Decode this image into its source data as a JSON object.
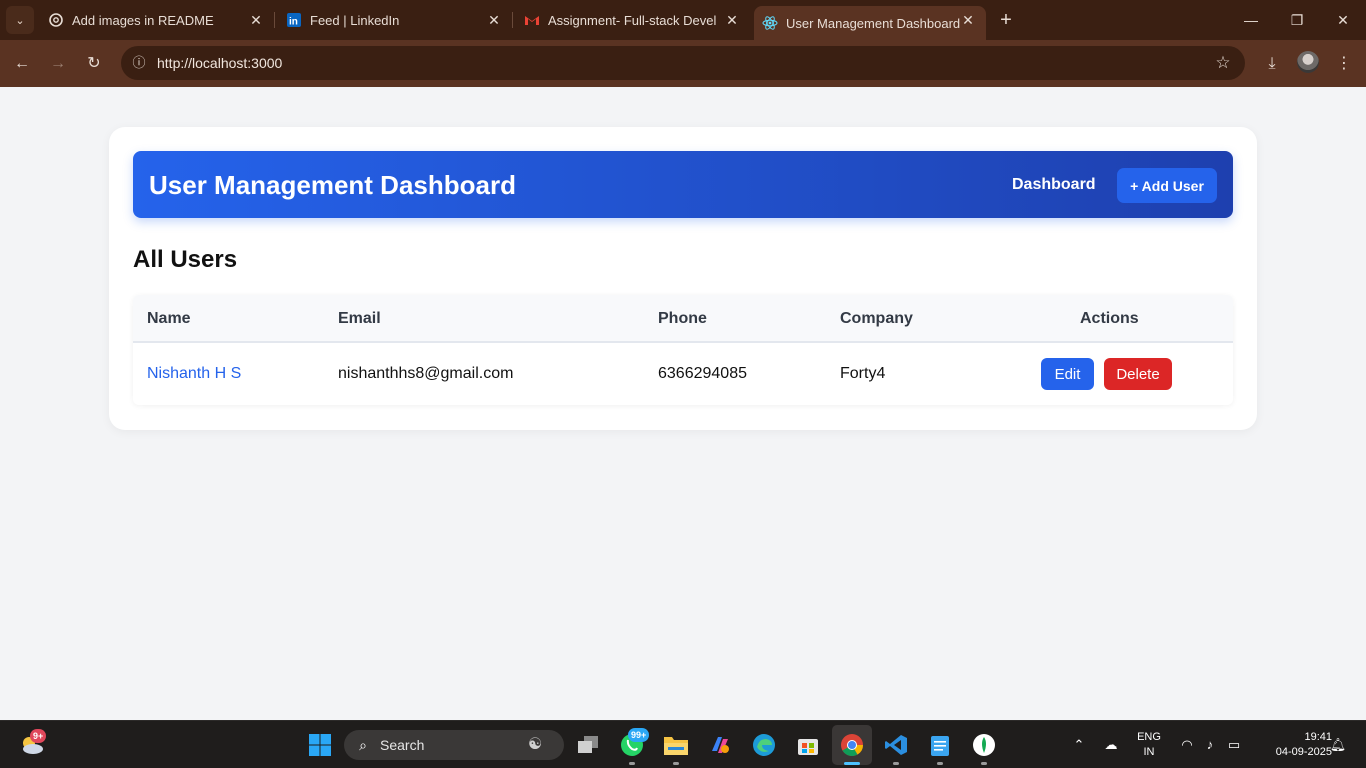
{
  "browser": {
    "tabs": [
      {
        "title": "Add images in README",
        "close": "✕"
      },
      {
        "title": "Feed | LinkedIn",
        "close": "✕"
      },
      {
        "title": "Assignment- Full-stack Develop",
        "close": "✕"
      },
      {
        "title": "User Management Dashboard",
        "close": "✕"
      }
    ],
    "new_tab": "+",
    "url": "http://localhost:3000",
    "window_controls": {
      "minimize": "—",
      "maximize": "❐",
      "close": "✕"
    }
  },
  "page": {
    "header": {
      "title": "User Management Dashboard",
      "nav_dashboard": "Dashboard",
      "add_user_button": "+ Add User"
    },
    "section_title": "All Users",
    "table": {
      "columns": [
        "Name",
        "Email",
        "Phone",
        "Company",
        "Actions"
      ],
      "rows": [
        {
          "name": "Nishanth H S",
          "email": "nishanthhs8@gmail.com",
          "phone": "6366294085",
          "company": "Forty4",
          "edit": "Edit",
          "delete": "Delete"
        }
      ]
    }
  },
  "taskbar": {
    "weather_badge": "9+",
    "search_label": "Search",
    "whatsapp_badge": "99+",
    "language": "ENG",
    "region": "IN",
    "time": "19:41",
    "date": "04-09-2025"
  },
  "colors": {
    "header_gradient_start": "#2563eb",
    "header_gradient_end": "#1e40af",
    "edit_button": "#2563eb",
    "delete_button": "#dc2626",
    "link": "#2563eb",
    "page_background": "#f3f4f6"
  },
  "icons": {
    "tab_list": "chevron-down-icon",
    "tab1": "chatgpt-icon",
    "tab2": "linkedin-icon",
    "tab3": "gmail-icon",
    "tab4": "react-icon",
    "back": "arrow-left-icon",
    "forward": "arrow-right-icon",
    "reload": "reload-icon",
    "site_info": "info-icon",
    "bookmark": "star-icon",
    "download": "download-icon",
    "menu": "kebab-menu-icon"
  }
}
